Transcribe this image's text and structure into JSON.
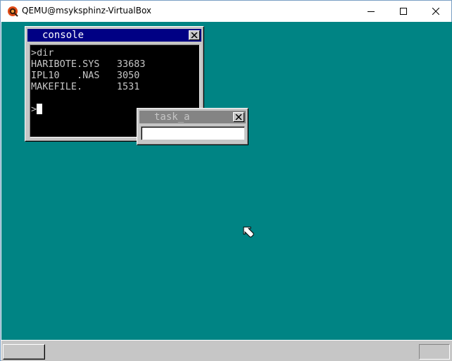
{
  "window": {
    "title": "QEMU@msyksphinz-VirtualBox",
    "app_icon": "qemu-icon",
    "controls": [
      "minimize-icon",
      "maximize-icon",
      "close-icon"
    ]
  },
  "desktop": {
    "background_color": "#008484"
  },
  "console_window": {
    "title": "console",
    "close_icon": "close-icon",
    "lines": [
      ">dir",
      "HARIBOTE.SYS   33683",
      "IPL10   .NAS   3050",
      "MAKEFILE.      1531",
      ""
    ],
    "prompt": ">"
  },
  "task_window": {
    "title": "task_a",
    "close_icon": "close-icon",
    "input_value": ""
  },
  "pointer": "mouse-cursor-icon",
  "taskbar": {
    "start_button_label": "",
    "tray_label": ""
  },
  "colors": {
    "active_title": "#000084",
    "inactive_title": "#848484",
    "window_face": "#c6c6c6",
    "console_bg": "#000000",
    "console_text": "#c6c6c6"
  }
}
